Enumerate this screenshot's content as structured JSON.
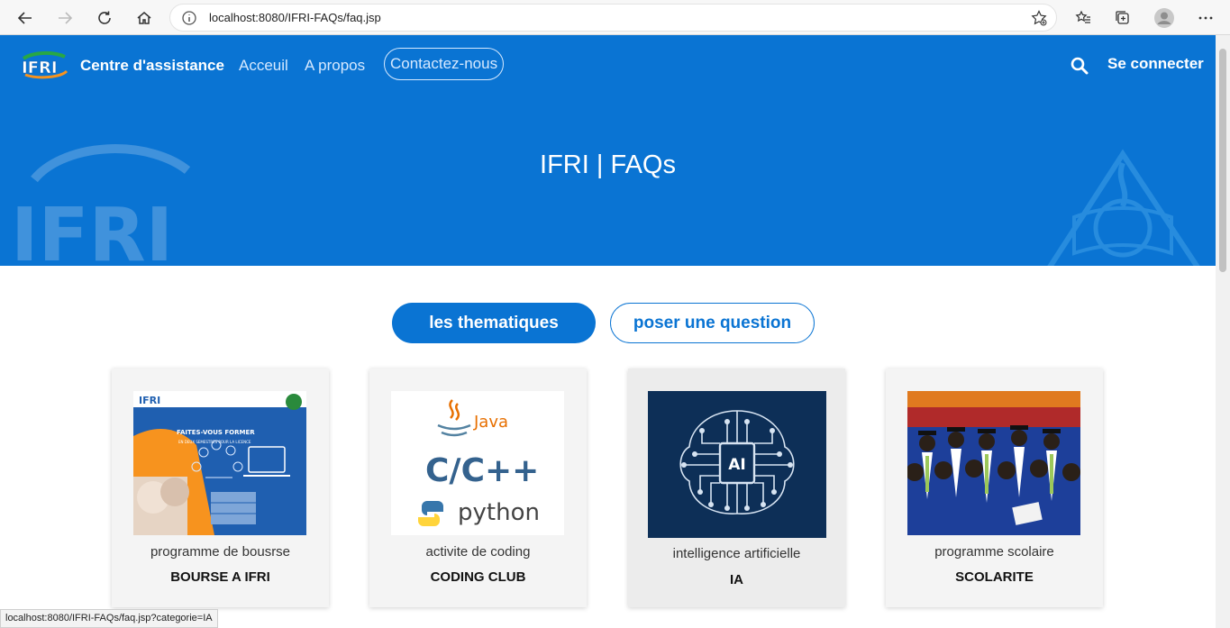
{
  "browser": {
    "url": "localhost:8080/IFRI-FAQs/faq.jsp",
    "status_url": "localhost:8080/IFRI-FAQs/faq.jsp?categorie=IA"
  },
  "header": {
    "brand_logo_text": "IFRI",
    "brand_name": "Centre d'assistance",
    "nav": {
      "home": "Acceuil",
      "about": "A propos",
      "contact": "Contactez-nous"
    },
    "login_label": "Se connecter",
    "hero_title": "IFRI | FAQs",
    "watermark_text": "IFRI"
  },
  "tabs": {
    "active": "les thematiques",
    "outline": "poser une question"
  },
  "cards": [
    {
      "desc": "programme de bousrse",
      "name": "BOURSE A IFRI",
      "poster_title": "FAITES-VOUS FORMER",
      "poster_sub": "EN DEUX SEMESTRES POUR LA LICENCE",
      "poster_logo": "IFRI"
    },
    {
      "desc": "activite de coding",
      "name": "CODING CLUB",
      "langs": {
        "java": "Java",
        "cpp": "C/C++",
        "python": "python"
      }
    },
    {
      "desc": "intelligence artificielle",
      "name": "IA",
      "chip": "AI"
    },
    {
      "desc": "programme scolaire",
      "name": "SCOLARITE"
    }
  ],
  "colors": {
    "primary": "#0a74d3",
    "card_bg": "#f4f4f4"
  }
}
